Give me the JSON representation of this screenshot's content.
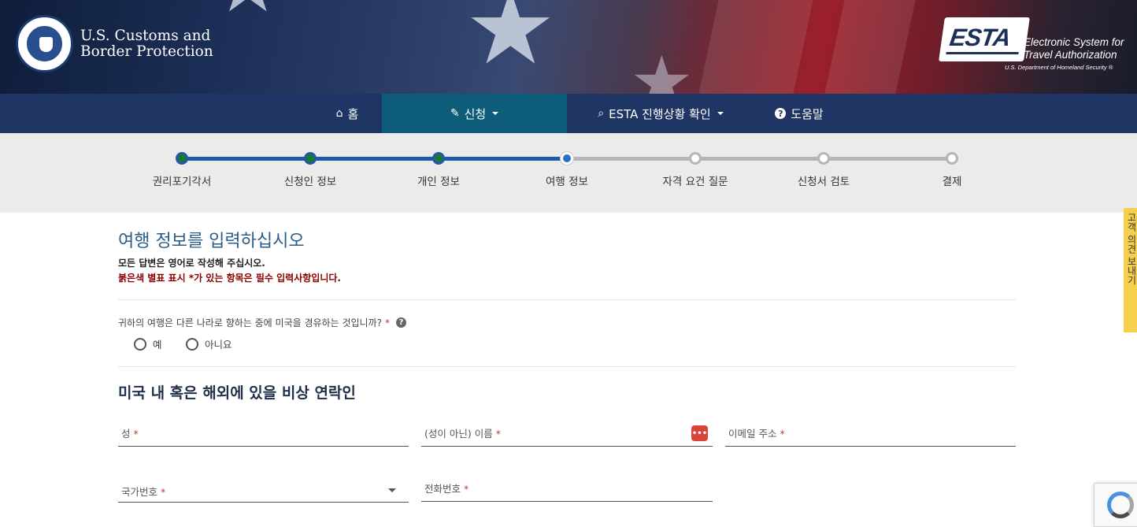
{
  "header": {
    "agency_line1": "U.S. Customs and",
    "agency_line2": "Border Protection",
    "esta_logo": "ESTA",
    "esta_line1": "Electronic System for",
    "esta_line2": "Travel Authorization",
    "esta_sub": "U.S. Department of Homeland Security ®"
  },
  "nav": {
    "home": "홈",
    "apply": "신청",
    "status": "ESTA 진행상황 확인",
    "help": "도움말"
  },
  "progress": {
    "steps": [
      "권리포기각서",
      "신청인 정보",
      "개인 정보",
      "여행 정보",
      "자격 요건 질문",
      "신청서 검토",
      "결제"
    ],
    "current_step": 4
  },
  "form": {
    "title": "여행 정보를 입력하십시오",
    "note_english": "모든 답변은 영어로 작성해 주십시오.",
    "note_required": "붉은색 별표 표시 *가 있는 항목은 필수 입력사항입니다.",
    "transit_question": "귀하의 여행은 다른 나라로 향하는 중에 미국을 경유하는 것입니까?",
    "required_mark": "*",
    "option_yes": "예",
    "option_no": "아니요",
    "emergency_section": "미국 내 혹은 해외에 있을 비상 연락인",
    "fields": {
      "last_name": "성",
      "first_name": "(성이 아닌) 이름",
      "email": "이메일 주소",
      "country_code": "국가번호",
      "phone": "전화번호"
    }
  },
  "feedback_tab": "고객 의견 보내기"
}
